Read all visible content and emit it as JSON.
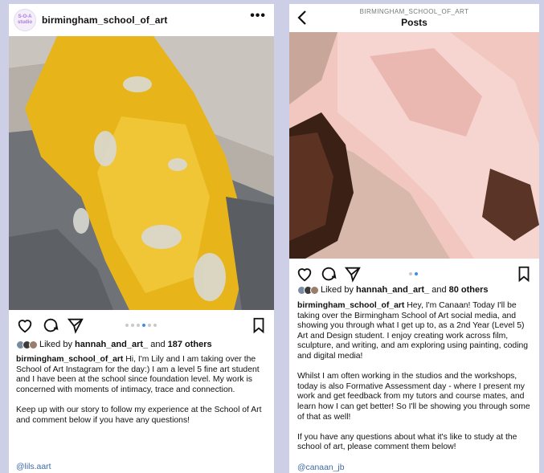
{
  "left_post": {
    "avatar_text": "S-O-A studio",
    "username": "birmingham_school_of_art",
    "more_icon": "more-horizontal-icon",
    "likes": {
      "prefix": "Liked by",
      "user": "hannah_and_art_",
      "middle": "and",
      "others": "187 others"
    },
    "caption_user": "birmingham_school_of_art",
    "caption_text": " Hi, I'm Lily and I am taking over the School of Art Instagram for the day:) I am a level 5 fine art student and I have been at the school since foundation level. My work is concerned with moments of intimacy, trace and connection.\n\nKeep up with our story to follow my experience at the School of Art and comment below if you have any questions!",
    "mention": "@lils.aart",
    "carousel": {
      "count": 6,
      "active": 4
    }
  },
  "right_post": {
    "header_subtitle": "BIRMINGHAM_SCHOOL_OF_ART",
    "header_title": "Posts",
    "back_icon": "chevron-left-icon",
    "likes": {
      "prefix": "Liked by",
      "user": "hannah_and_art_",
      "middle": "and",
      "others": "80 others"
    },
    "caption_user": "birmingham_school_of_art",
    "caption_text": " Hey, I'm Canaan! Today I'll be taking over the Birmingham School of Art social media, and showing you through what I get up to, as a 2nd Year (Level 5) Art and Design student. I enjoy creating work across film, sculpture, and writing, and am exploring using painting, coding and digital media!\n\nWhilst I am often working in the studios and the workshops, today is also Formative Assessment day - where I present my work and get feedback from my tutors and course mates, and learn how I can get better! So I'll be showing you through some of that as well!\n\nIf you have any questions about what it's like to study at the school of art, please comment them below!",
    "mention": "@canaan_jb",
    "carousel": {
      "count": 2,
      "active": 2
    }
  },
  "colors": {
    "background": "#cdcfe6",
    "link": "#3f6aa3",
    "carousel_active": "#3a90e8"
  }
}
